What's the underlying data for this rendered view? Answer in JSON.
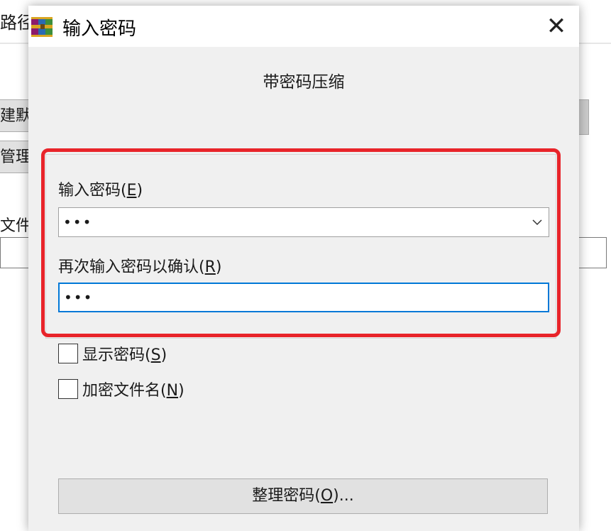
{
  "background_window": {
    "title_fragment": "路径",
    "button1_fragment": "建默",
    "button2_fragment": "管理",
    "file_label_fragment": "文件"
  },
  "dialog": {
    "title": "输入密码",
    "heading": "带密码压缩",
    "password_label": "输入密码(",
    "password_label_key": "E",
    "password_value": "•••",
    "confirm_label": "再次输入密码以确认(",
    "confirm_label_key": "R",
    "confirm_value": "•••",
    "show_password_label": "显示密码(",
    "show_password_key": "S",
    "show_password_checked": false,
    "encrypt_names_label": "加密文件名(",
    "encrypt_names_key": "N",
    "encrypt_names_checked": false,
    "organize_label": "整理密码(",
    "organize_key": "O",
    "organize_suffix": ")...",
    "close_symbol": "✕",
    "dropdown_icon": "chevron-down-icon",
    "highlight_color": "#e8242a",
    "focus_color": "#0078d7"
  }
}
